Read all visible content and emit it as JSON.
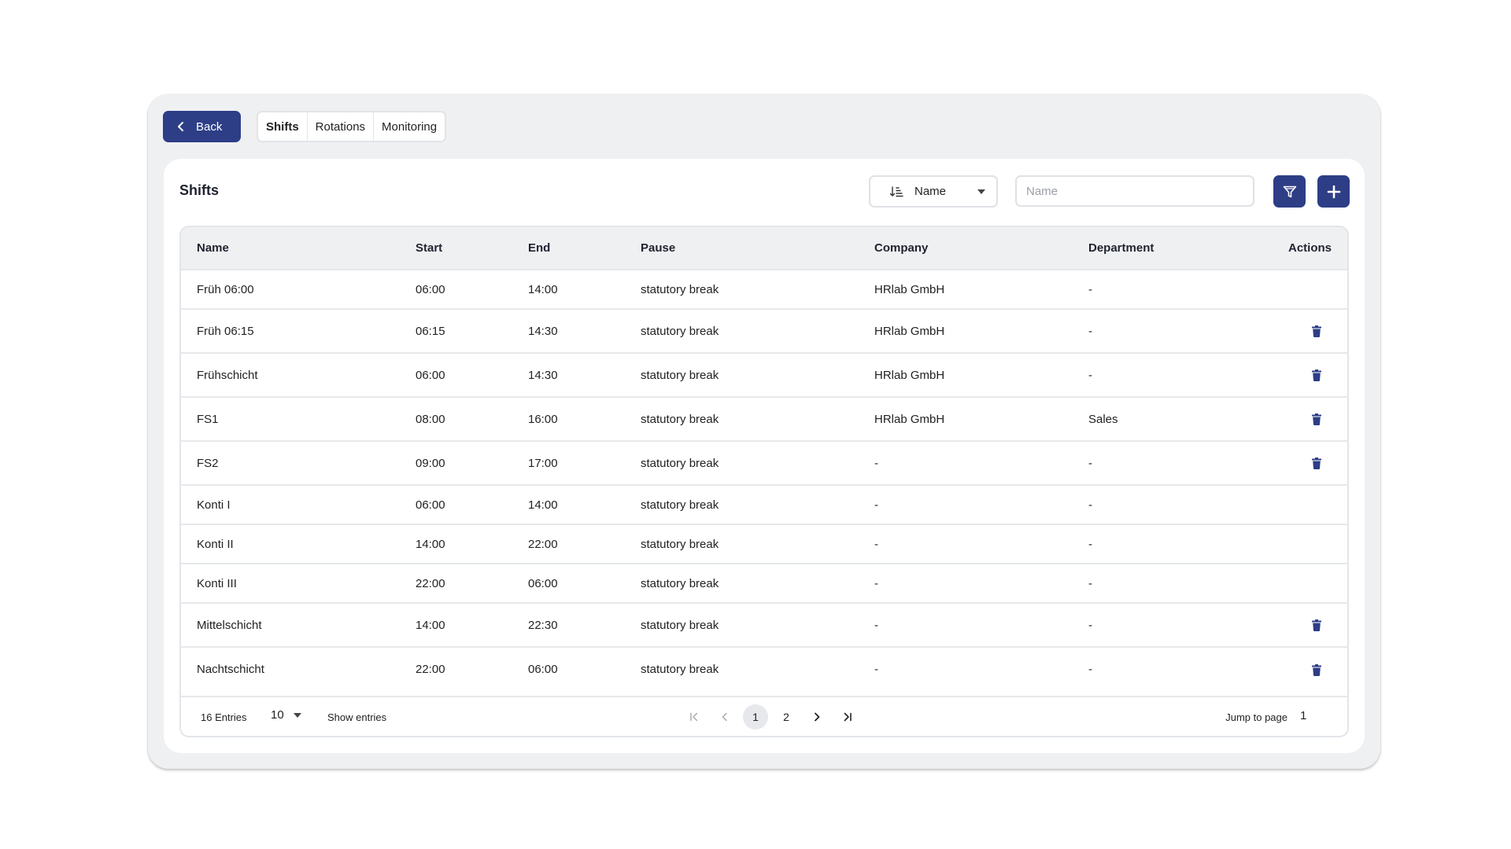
{
  "header": {
    "back_label": "Back",
    "tabs": [
      {
        "label": "Shifts",
        "active": true
      },
      {
        "label": "Rotations",
        "active": false
      },
      {
        "label": "Monitoring",
        "active": false
      }
    ]
  },
  "card": {
    "title": "Shifts",
    "sort": {
      "selected": "Name"
    },
    "search": {
      "placeholder": "Name",
      "value": ""
    }
  },
  "table": {
    "columns": [
      "Name",
      "Start",
      "End",
      "Pause",
      "Company",
      "Department",
      "Actions"
    ],
    "rows": [
      {
        "name": "Früh 06:00",
        "start": "06:00",
        "end": "14:00",
        "pause": "statutory break",
        "company": "HRlab GmbH",
        "department": "-",
        "deletable": false
      },
      {
        "name": "Früh 06:15",
        "start": "06:15",
        "end": "14:30",
        "pause": "statutory break",
        "company": "HRlab GmbH",
        "department": "-",
        "deletable": true
      },
      {
        "name": "Frühschicht",
        "start": "06:00",
        "end": "14:30",
        "pause": "statutory break",
        "company": "HRlab GmbH",
        "department": "-",
        "deletable": true
      },
      {
        "name": "FS1",
        "start": "08:00",
        "end": "16:00",
        "pause": "statutory break",
        "company": "HRlab GmbH",
        "department": "Sales",
        "deletable": true
      },
      {
        "name": "FS2",
        "start": "09:00",
        "end": "17:00",
        "pause": "statutory break",
        "company": "-",
        "department": "-",
        "deletable": true
      },
      {
        "name": "Konti I",
        "start": "06:00",
        "end": "14:00",
        "pause": "statutory break",
        "company": "-",
        "department": "-",
        "deletable": false
      },
      {
        "name": "Konti II",
        "start": "14:00",
        "end": "22:00",
        "pause": "statutory break",
        "company": "-",
        "department": "-",
        "deletable": false
      },
      {
        "name": "Konti III",
        "start": "22:00",
        "end": "06:00",
        "pause": "statutory break",
        "company": "-",
        "department": "-",
        "deletable": false
      },
      {
        "name": "Mittelschicht",
        "start": "14:00",
        "end": "22:30",
        "pause": "statutory break",
        "company": "-",
        "department": "-",
        "deletable": true
      },
      {
        "name": "Nachtschicht",
        "start": "22:00",
        "end": "06:00",
        "pause": "statutory break",
        "company": "-",
        "department": "-",
        "deletable": true
      }
    ]
  },
  "pager": {
    "entries_label": "16 Entries",
    "per_page": "10",
    "show_label": "Show entries",
    "pages": [
      "1",
      "2"
    ],
    "current_page": "1",
    "jump_label": "Jump to page",
    "jump_value": "1"
  },
  "colors": {
    "primary": "#2d3e86",
    "window_bg": "#eff0f2",
    "border": "#e3e5e9"
  },
  "icons": {
    "back": "chevron-left-icon",
    "sort": "sort-ascending-icon",
    "filter": "filter-icon",
    "add": "plus-icon",
    "delete": "trash-icon",
    "first": "first-page-icon",
    "prev": "chevron-left-icon",
    "next": "chevron-right-icon",
    "last": "last-page-icon"
  }
}
